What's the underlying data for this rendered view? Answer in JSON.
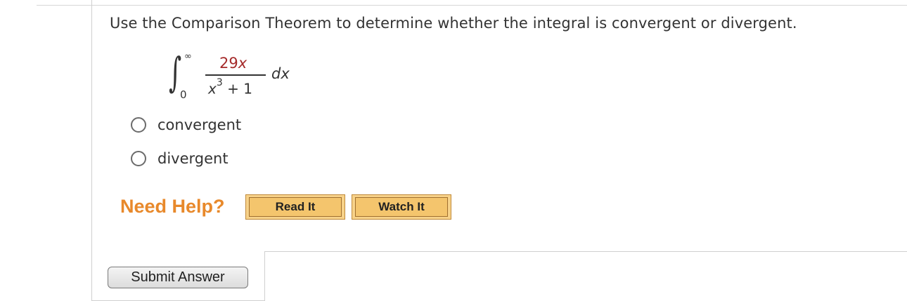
{
  "question": {
    "text": "Use the Comparison Theorem to determine whether the integral is convergent or divergent."
  },
  "integral": {
    "upper_limit": "∞",
    "lower_limit": "0",
    "numerator_coeff": "29",
    "numerator_var": "x",
    "denominator_base": "x",
    "denominator_exp": "3",
    "denominator_rest": " + 1",
    "differential": "dx",
    "numerator_color": "#a52a2a"
  },
  "options": [
    {
      "label": "convergent",
      "selected": false
    },
    {
      "label": "divergent",
      "selected": false
    }
  ],
  "help": {
    "label": "Need Help?",
    "read_it": "Read It",
    "watch_it": "Watch It",
    "color": "#e8892b"
  },
  "submit": {
    "label": "Submit Answer"
  }
}
